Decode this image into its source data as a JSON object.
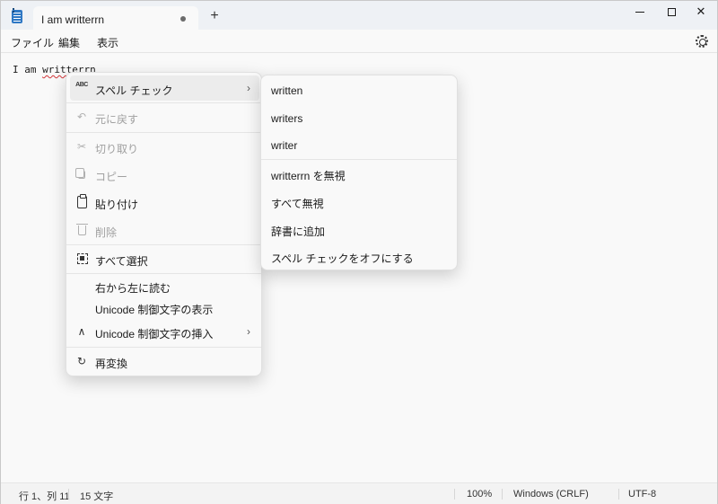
{
  "window": {
    "tab_title": "I am writterrn",
    "new_tab": "+",
    "minimize": "",
    "maximize": "",
    "close": "✕"
  },
  "menubar": {
    "file": "ファイル",
    "edit": "編集",
    "view": "表示"
  },
  "editor": {
    "text_before": "I am ",
    "misspelled_word": "writterrn"
  },
  "context_menu": {
    "spell_check": "スペル チェック",
    "undo": "元に戻す",
    "cut": "切り取り",
    "copy": "コピー",
    "paste": "貼り付け",
    "delete": "削除",
    "select_all": "すべて選択",
    "rtl": "右から左に読む",
    "show_unicode": "Unicode 制御文字の表示",
    "insert_unicode": "Unicode 制御文字の挿入",
    "reconvert": "再変換",
    "spell_icon_text": "ABC"
  },
  "spell_submenu": {
    "suggestions": [
      "written",
      "writers",
      "writer"
    ],
    "ignore": "writterrn を無視",
    "ignore_all": "すべて無視",
    "add_to_dictionary": "辞書に追加",
    "turn_off": "スペル チェックをオフにする"
  },
  "statusbar": {
    "position": "行 1、列 11",
    "char_count": "15 文字",
    "zoom": "100%",
    "line_ending": "Windows (CRLF)",
    "encoding": "UTF-8"
  }
}
